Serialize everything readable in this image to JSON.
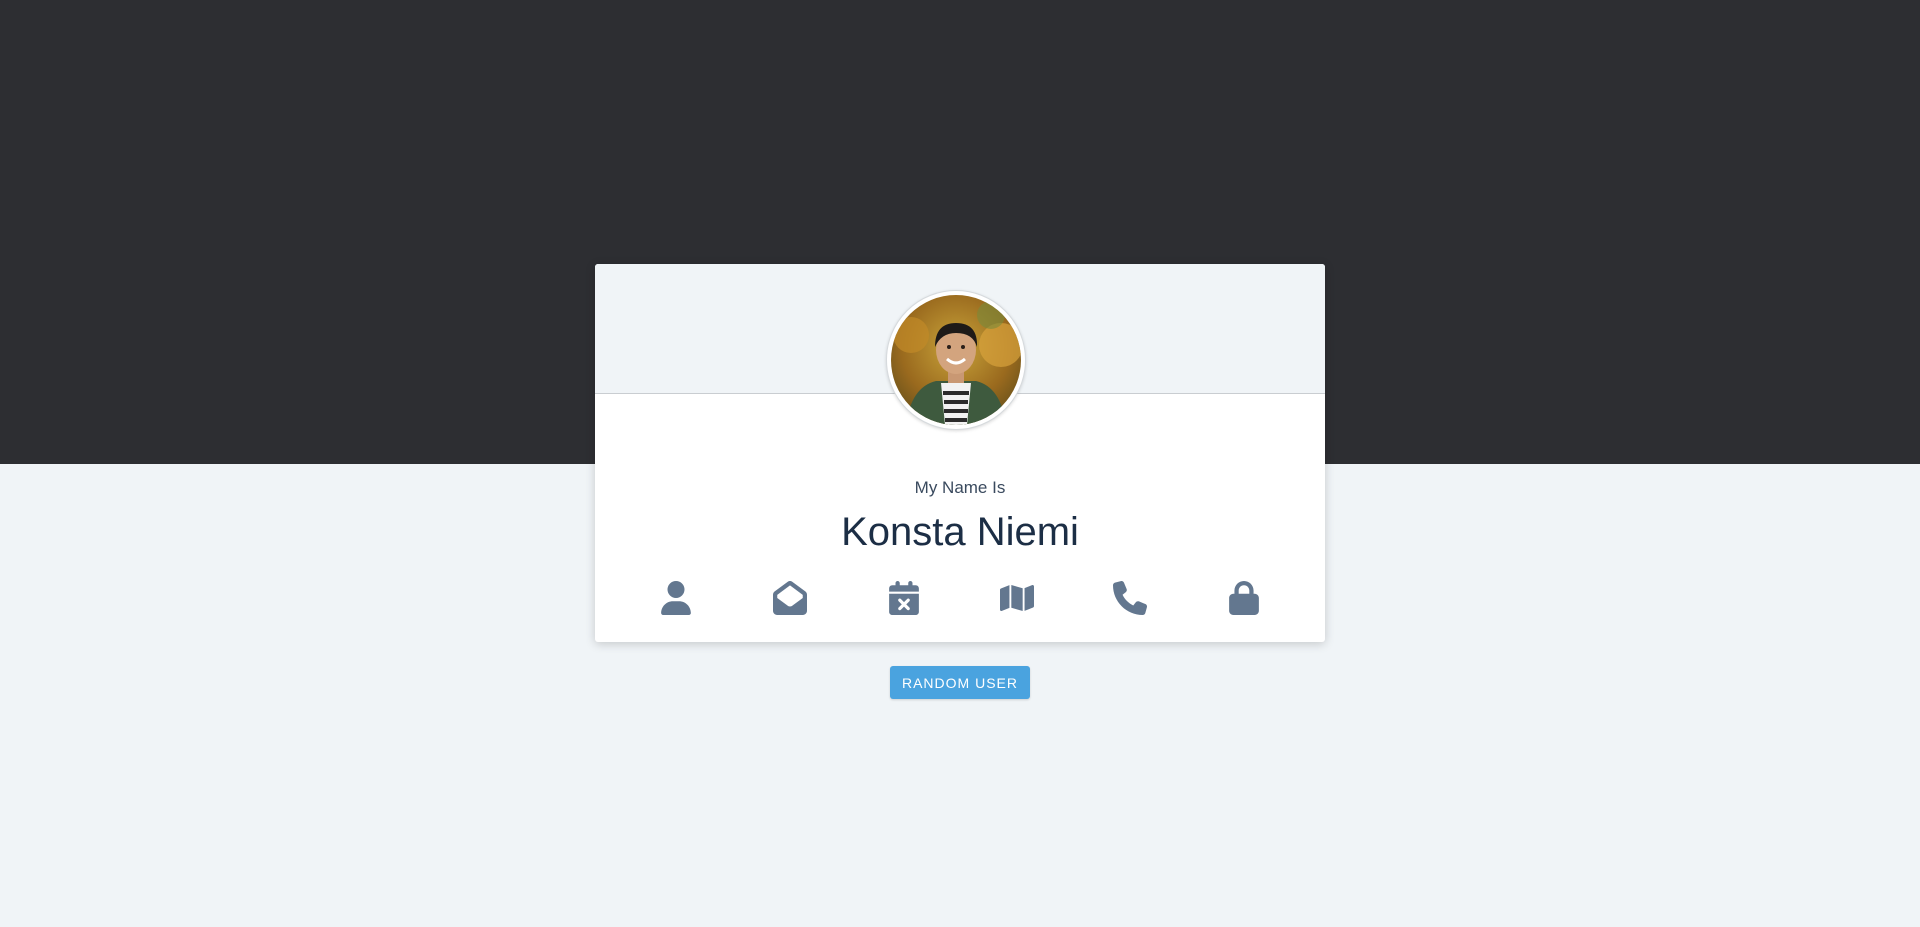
{
  "profile": {
    "label": "My Name Is",
    "value": "Konsta Niemi"
  },
  "icons": [
    {
      "name": "user-icon"
    },
    {
      "name": "envelope-open-icon"
    },
    {
      "name": "calendar-times-icon"
    },
    {
      "name": "map-icon"
    },
    {
      "name": "phone-icon"
    },
    {
      "name": "lock-icon"
    }
  ],
  "actions": {
    "random_button_label": "RANDOM USER"
  },
  "colors": {
    "top_band": "#2d2e32",
    "page_background": "#f0f4f7",
    "icon": "#63778f",
    "button": "#4aa3df",
    "name_text": "#1c2e45"
  }
}
